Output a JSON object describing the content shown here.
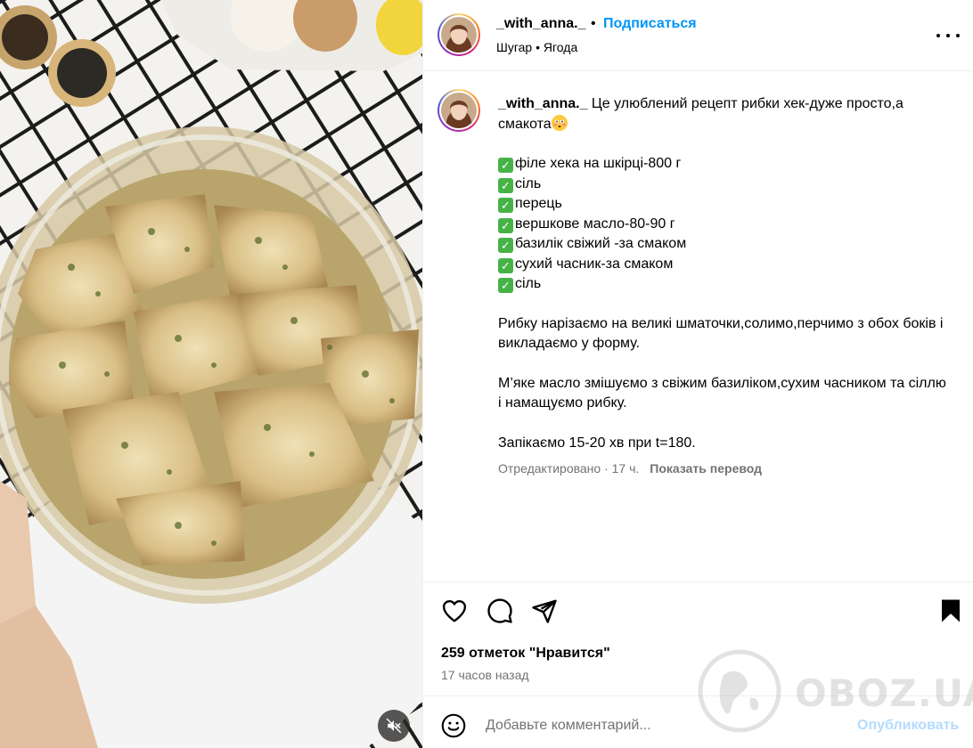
{
  "header": {
    "username": "_with_anna._",
    "separator": "•",
    "follow_label": "Подписаться",
    "audio": "Шугар • Ягода",
    "more_icon": "more-horizontal-icon"
  },
  "caption": {
    "username": "_with_anna._",
    "intro": " Це улюблений рецепт рибки хек-дуже просто,а смакота",
    "intro_emoji": "flushed-face-emoji",
    "ingredients": [
      "філе хека на шкірці-800 г",
      "сіль",
      "перець",
      "вершкове масло-80-90 г",
      "базилік свіжий -за смаком",
      "сухий часник-за смаком",
      "сіль"
    ],
    "steps": [
      "Рибку нарізаємо на великі шматочки,солимо,перчимо з обох боків і викладаємо у форму.",
      "М’яке масло змішуємо з свіжим базиліком,сухим часником та сіллю і намащуємо рибку.",
      "Запікаємо 15-20 хв при t=180."
    ],
    "meta": "Отредактировано · 17 ч.",
    "translate_label": "Показать перевод"
  },
  "actions": {
    "icons": [
      "heart-icon",
      "comment-icon",
      "share-icon",
      "bookmark-icon"
    ],
    "likes": "259 отметок \"Нравится\"",
    "time_ago": "17 часов назад"
  },
  "comment": {
    "placeholder": "Добавьте комментарий...",
    "post_label": "Опубликовать"
  },
  "watermark": "OBOZ.UA",
  "colors": {
    "accent": "#0095f6",
    "post_disabled": "#b3dbff",
    "secondary_text": "#737373",
    "check_green": "#47b347"
  }
}
